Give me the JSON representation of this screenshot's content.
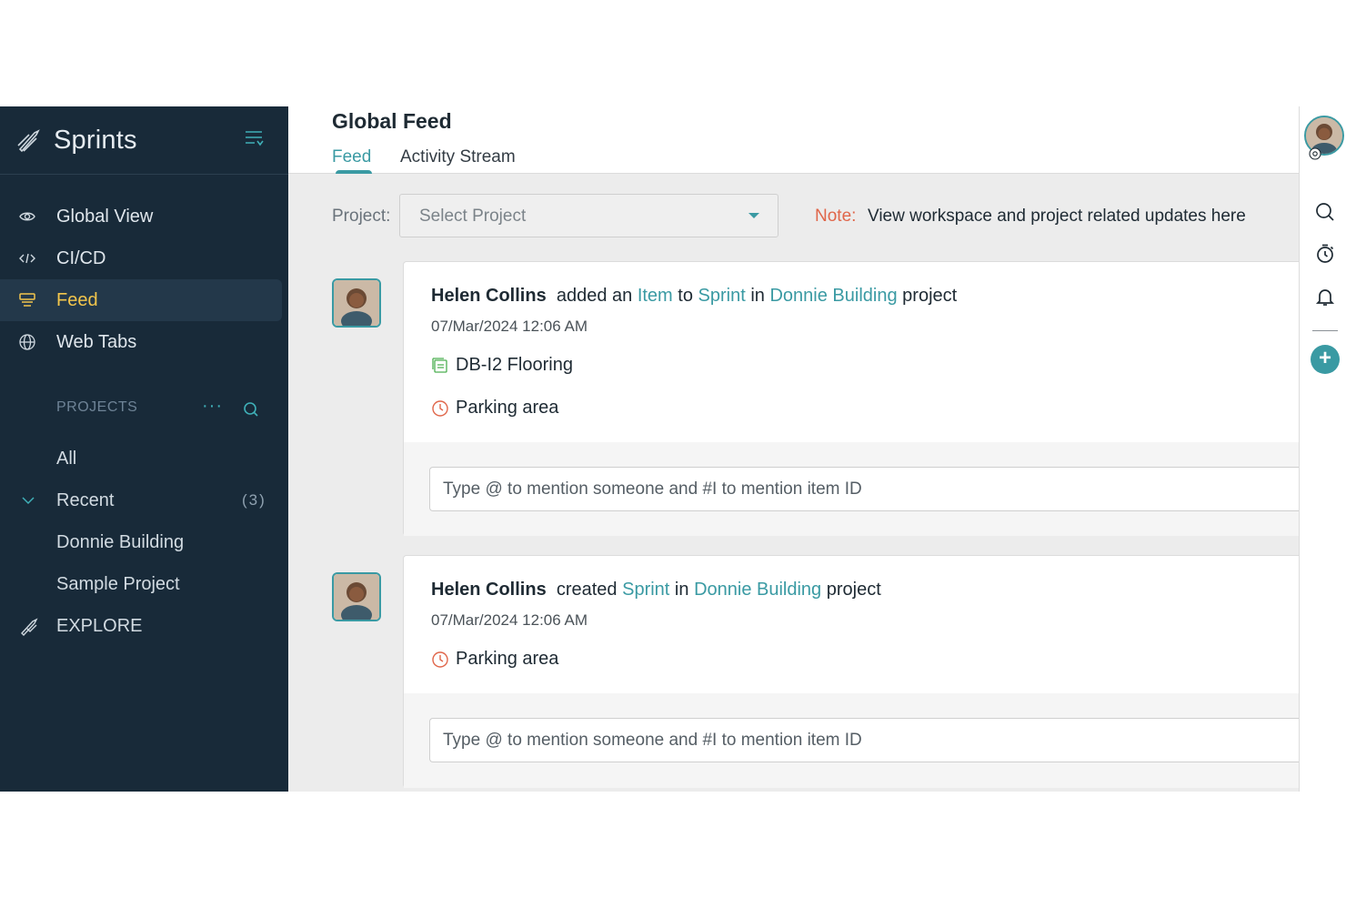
{
  "app": {
    "name": "Sprints"
  },
  "sidebar": {
    "nav": [
      {
        "label": "Global View",
        "icon": "eye-icon"
      },
      {
        "label": "CI/CD",
        "icon": "code-icon"
      },
      {
        "label": "Feed",
        "icon": "feed-icon",
        "active": true
      },
      {
        "label": "Web Tabs",
        "icon": "globe-icon"
      }
    ],
    "projects_heading": "PROJECTS",
    "projects_more": "···",
    "project_list": {
      "all": "All",
      "recent": "Recent",
      "recent_count": "(3)",
      "items": [
        "Donnie Building",
        "Sample Project"
      ]
    },
    "explore": "EXPLORE"
  },
  "header": {
    "title": "Global Feed",
    "tabs": [
      {
        "label": "Feed",
        "active": true
      },
      {
        "label": "Activity Stream"
      }
    ]
  },
  "filter": {
    "label": "Project:",
    "select_value": "Select Project",
    "note_key": "Note:",
    "note_text": "View workspace and project related updates here"
  },
  "feed": [
    {
      "user": "Helen Collins",
      "action": "added an",
      "item": "Item",
      "to": "to",
      "sprint": "Sprint",
      "in": "in",
      "project": "Donnie Building",
      "suffix": "project",
      "timestamp": "07/Mar/2024 12:06 AM",
      "details": [
        {
          "icon": "item-icon",
          "text": "DB-I2  Flooring"
        },
        {
          "icon": "sprint-icon",
          "text": "Parking area"
        }
      ],
      "comment_placeholder": "Type @ to mention someone and #I to mention item ID"
    },
    {
      "user": "Helen Collins",
      "action": "created",
      "sprint": "Sprint",
      "in": "in",
      "project": "Donnie Building",
      "suffix": "project",
      "timestamp": "07/Mar/2024 12:06 AM",
      "details": [
        {
          "icon": "sprint-icon",
          "text": "Parking area"
        }
      ],
      "comment_placeholder": "Type @ to mention someone and #I to mention item ID"
    }
  ],
  "colors": {
    "sidebar_bg": "#182a39",
    "accent": "#3a9aa3",
    "active_nav": "#f3c64c",
    "note": "#e0664a"
  }
}
